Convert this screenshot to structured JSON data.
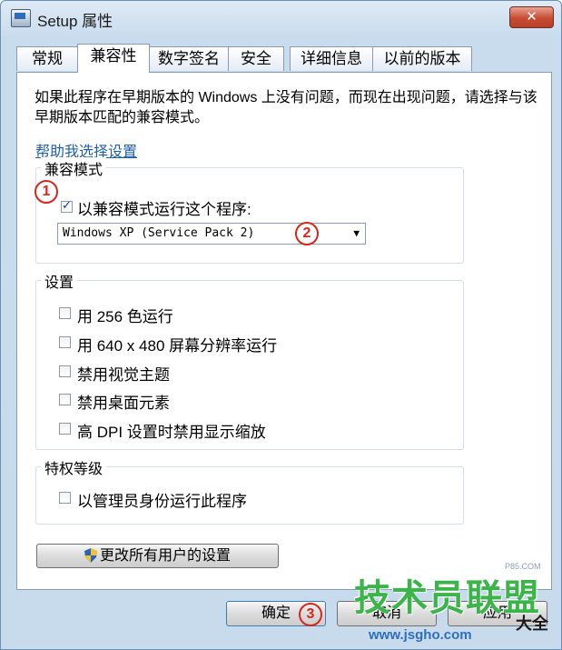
{
  "window": {
    "title": "Setup 属性",
    "close_label": "✕"
  },
  "tabs": [
    {
      "label": "常规"
    },
    {
      "label": "兼容性"
    },
    {
      "label": "数字签名"
    },
    {
      "label": "安全"
    },
    {
      "label": "详细信息"
    },
    {
      "label": "以前的版本"
    }
  ],
  "active_tab": "兼容性",
  "description": "如果此程序在早期版本的 Windows 上没有问题，而现在出现问题，请选择与该早期版本匹配的兼容模式。",
  "help_link": "帮助我选择设置",
  "compat_mode": {
    "group_label": "兼容模式",
    "checkbox_label": "以兼容模式运行这个程序:",
    "checked": true,
    "selected_os": "Windows XP (Service Pack 2)"
  },
  "settings": {
    "group_label": "设置",
    "items": [
      {
        "label": "用 256 色运行",
        "checked": false
      },
      {
        "label": "用 640 x 480 屏幕分辨率运行",
        "checked": false
      },
      {
        "label": "禁用视觉主题",
        "checked": false
      },
      {
        "label": "禁用桌面元素",
        "checked": false
      },
      {
        "label": "高 DPI 设置时禁用显示缩放",
        "checked": false
      }
    ]
  },
  "privilege": {
    "group_label": "特权等级",
    "checkbox_label": "以管理员身份运行此程序",
    "checked": false
  },
  "all_users_button": "更改所有用户的设置",
  "buttons": {
    "ok": "确定",
    "cancel": "取消",
    "apply": "应用"
  },
  "markers": [
    "1",
    "2",
    "3"
  ],
  "watermark": {
    "main": "技术员联盟",
    "url": "www.jsgho.com",
    "side": "大全",
    "small": "P85.COM"
  },
  "colors": {
    "marker": "#d7261c",
    "watermark": "#3bb44a",
    "link": "#1f5fa8"
  }
}
